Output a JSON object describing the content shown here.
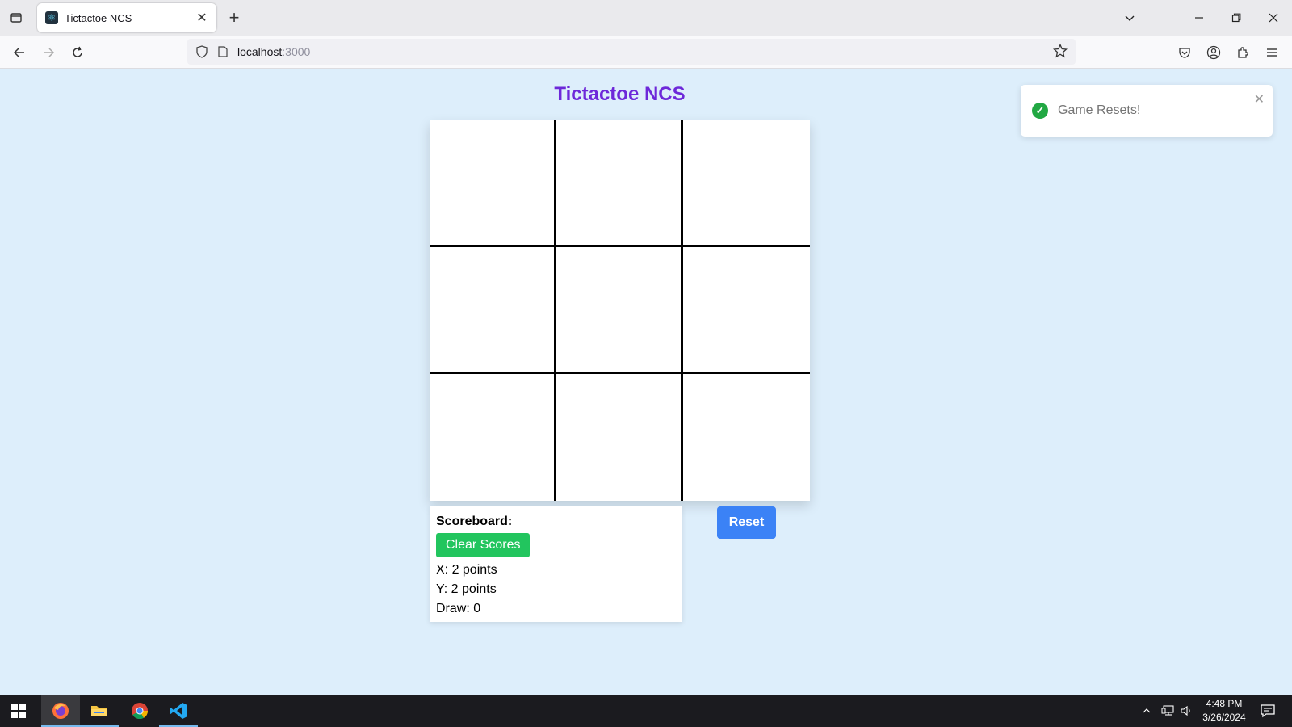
{
  "browser": {
    "tab_title": "Tictactoe NCS",
    "tab_close": "✕",
    "new_tab": "+",
    "url_host": "localhost",
    "url_port": ":3000"
  },
  "app": {
    "title": "Tictactoe NCS",
    "board_cells": [
      "",
      "",
      "",
      "",
      "",
      "",
      "",
      "",
      ""
    ]
  },
  "scoreboard": {
    "title": "Scoreboard:",
    "clear_label": "Clear Scores",
    "x_line": "X: 2 points",
    "y_line": "Y: 2 points",
    "draw_line": "Draw: 0"
  },
  "reset_label": "Reset",
  "toast": {
    "message": "Game Resets!",
    "check": "✓",
    "close": "✕"
  },
  "taskbar": {
    "time": "4:48 PM",
    "date": "3/26/2024"
  },
  "colors": {
    "page_bg": "#ddeefb",
    "title": "#6d28d9",
    "clear_btn": "#22c55e",
    "reset_btn": "#3b82f6",
    "toast_check": "#22a843"
  }
}
